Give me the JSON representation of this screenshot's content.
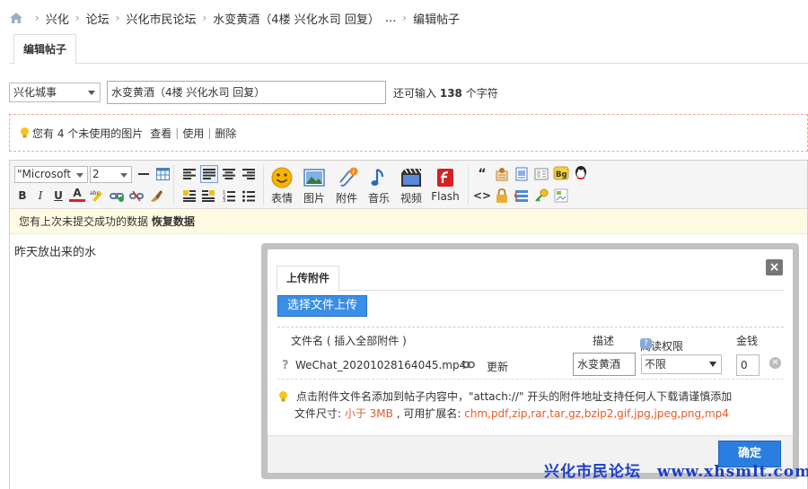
{
  "breadcrumb": {
    "items": [
      "兴化",
      "论坛",
      "兴化市民论坛",
      "水变黄酒（4楼 兴化水司 回复）",
      "...",
      "编辑帖子"
    ],
    "separator": "›"
  },
  "tab": {
    "label": "编辑帖子"
  },
  "title_row": {
    "category": "兴化城事",
    "subject": "水变黄酒（4楼 兴化水司 回复）",
    "counter_prefix": "还可输入",
    "counter_value": "138",
    "counter_suffix": "个字符"
  },
  "image_notice": {
    "text": "您有 4 个未使用的图片",
    "view": "查看",
    "use": "使用",
    "delete": "删除"
  },
  "toolbar": {
    "font": "\"Microsoft",
    "size": "2",
    "bold": "B",
    "italic": "I",
    "underline": "U",
    "font_color": "A",
    "big_buttons": [
      {
        "label": "表情",
        "icon": "smiley-icon"
      },
      {
        "label": "图片",
        "icon": "image-icon"
      },
      {
        "label": "附件",
        "icon": "paperclip-icon"
      },
      {
        "label": "音乐",
        "icon": "music-note-icon"
      },
      {
        "label": "视频",
        "icon": "film-icon"
      },
      {
        "label": "Flash",
        "icon": "flash-icon"
      }
    ],
    "code_label": "<>",
    "quote_label": "“"
  },
  "draft": {
    "text": "您有上次未提交成功的数据",
    "restore": "恢复数据"
  },
  "editor_content": "昨天放出来的水",
  "dialog": {
    "tab": "上传附件",
    "close": "×",
    "upload_button": "选择文件上传",
    "headers": {
      "filename": "文件名 ( 插入全部附件 )",
      "description": "描述",
      "permission": "阅读权限",
      "money": "金钱"
    },
    "row": {
      "unknown": "?",
      "filename": "WeChat_20201028164045.mp4",
      "update": "更新",
      "description": "水变黄酒",
      "permission": "不限",
      "money": "0"
    },
    "tip1": "点击附件文件名添加到帖子内容中，\"attach://\" 开头的附件地址支持任何人下载请谨慎添加",
    "tip2_prefix": "文件尺寸: ",
    "tip2_size": "小于 3MB",
    "tip2_mid": " , 可用扩展名: ",
    "tip2_ext": "chm,pdf,zip,rar,tar,gz,bzip2,gif,jpg,jpeg,png,mp4",
    "confirm": "确定"
  },
  "watermark": {
    "name": "兴化市民论坛",
    "url": "www.xhsmlt.com"
  },
  "colors": {
    "primary_button": "#2a7ee0",
    "upload_button": "#3a8ee6",
    "watermark": "#1a3ec8",
    "notice_border": "#f0a8a0",
    "draft_bg": "#fffbe3",
    "tip_red": "#e65a2a"
  }
}
